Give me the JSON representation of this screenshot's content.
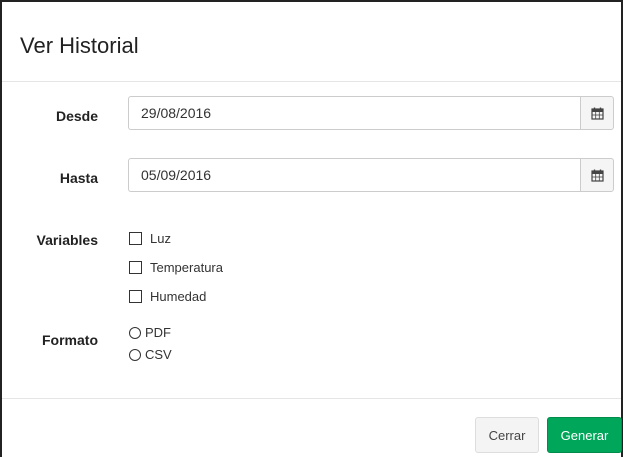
{
  "modal": {
    "title": "Ver Historial"
  },
  "form": {
    "desde": {
      "label": "Desde",
      "value": "29/08/2016"
    },
    "hasta": {
      "label": "Hasta",
      "value": "05/09/2016"
    },
    "variables": {
      "label": "Variables",
      "options": [
        "Luz",
        "Temperatura",
        "Humedad"
      ]
    },
    "formato": {
      "label": "Formato",
      "options": [
        "PDF",
        "CSV"
      ]
    }
  },
  "footer": {
    "close_label": "Cerrar",
    "generate_label": "Generar"
  },
  "colors": {
    "generate_button": "#00a65a",
    "close_button": "#f4f4f4"
  },
  "icons": {
    "date_picker": "calendar-icon"
  }
}
